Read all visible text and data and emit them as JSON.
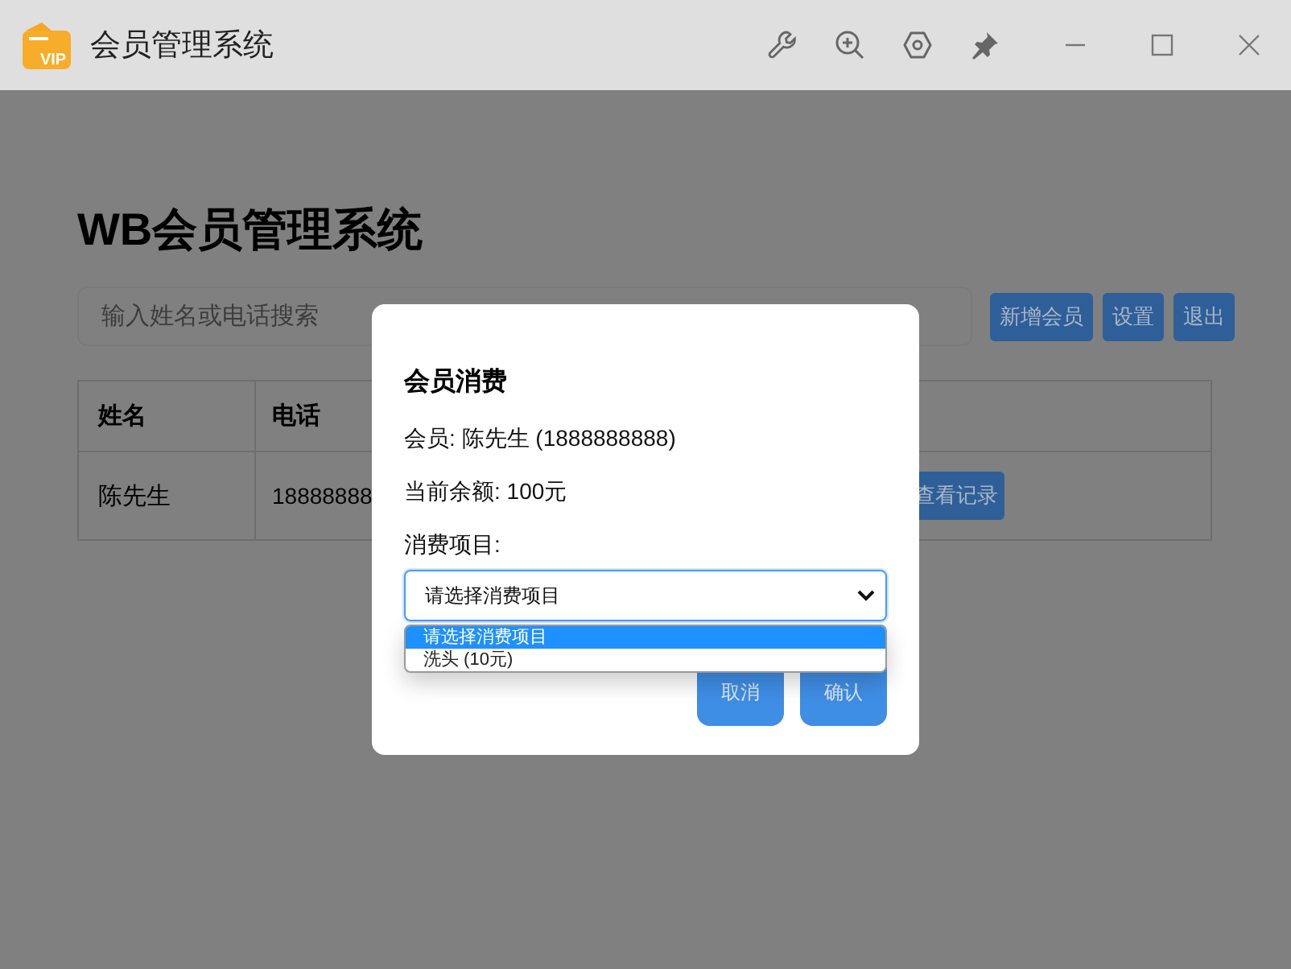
{
  "window": {
    "title": "会员管理系统",
    "logo_text": "VIP"
  },
  "page": {
    "heading": "WB会员管理系统",
    "search": {
      "placeholder": "输入姓名或电话搜索"
    },
    "buttons": [
      "新增会员",
      "设置",
      "退出"
    ],
    "table": {
      "columns": [
        "姓名",
        "电话"
      ],
      "rows": [
        {
          "cells": [
            "陈先生",
            "18888888"
          ],
          "action": "查看记录"
        }
      ]
    }
  },
  "dialog": {
    "title": "会员消费",
    "lines": [
      "会员: 陈先生 (1888888888)",
      "当前余额: 100元"
    ],
    "field_label": "消费项目:",
    "select": {
      "value": "请选择消费项目",
      "expanded": true,
      "options": [
        {
          "label": "请选择消费项目",
          "selected": true
        },
        {
          "label": "洗头 (10元)",
          "selected": false
        }
      ]
    },
    "buttons": [
      "取消",
      "确认"
    ]
  }
}
